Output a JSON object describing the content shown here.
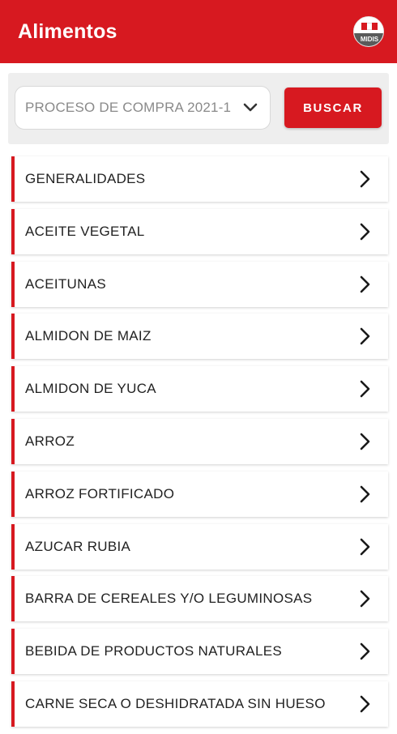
{
  "app_bar": {
    "title": "Alimentos",
    "logo_text": "MIDIS",
    "logo_icon": "government-logo-icon"
  },
  "filter": {
    "selected_process": "PROCESO DE COMPRA 2021-1",
    "dropdown_icon": "chevron-down-icon",
    "search_label": "BUSCAR"
  },
  "categories": [
    {
      "label": "GENERALIDADES"
    },
    {
      "label": "ACEITE VEGETAL"
    },
    {
      "label": "ACEITUNAS"
    },
    {
      "label": "ALMIDON DE MAIZ"
    },
    {
      "label": "ALMIDON DE YUCA"
    },
    {
      "label": "ARROZ"
    },
    {
      "label": "ARROZ FORTIFICADO"
    },
    {
      "label": "AZUCAR RUBIA"
    },
    {
      "label": "BARRA DE CEREALES Y/O LEGUMINOSAS"
    },
    {
      "label": "BEBIDA DE PRODUCTOS NATURALES"
    },
    {
      "label": "CARNE SECA O DESHIDRATADA SIN HUESO"
    }
  ],
  "item_icon": "chevron-right-icon",
  "colors": {
    "primary": "#d71920",
    "panel_bg": "#eeeeee",
    "text": "#222222",
    "placeholder_text": "#8a8a8a"
  }
}
